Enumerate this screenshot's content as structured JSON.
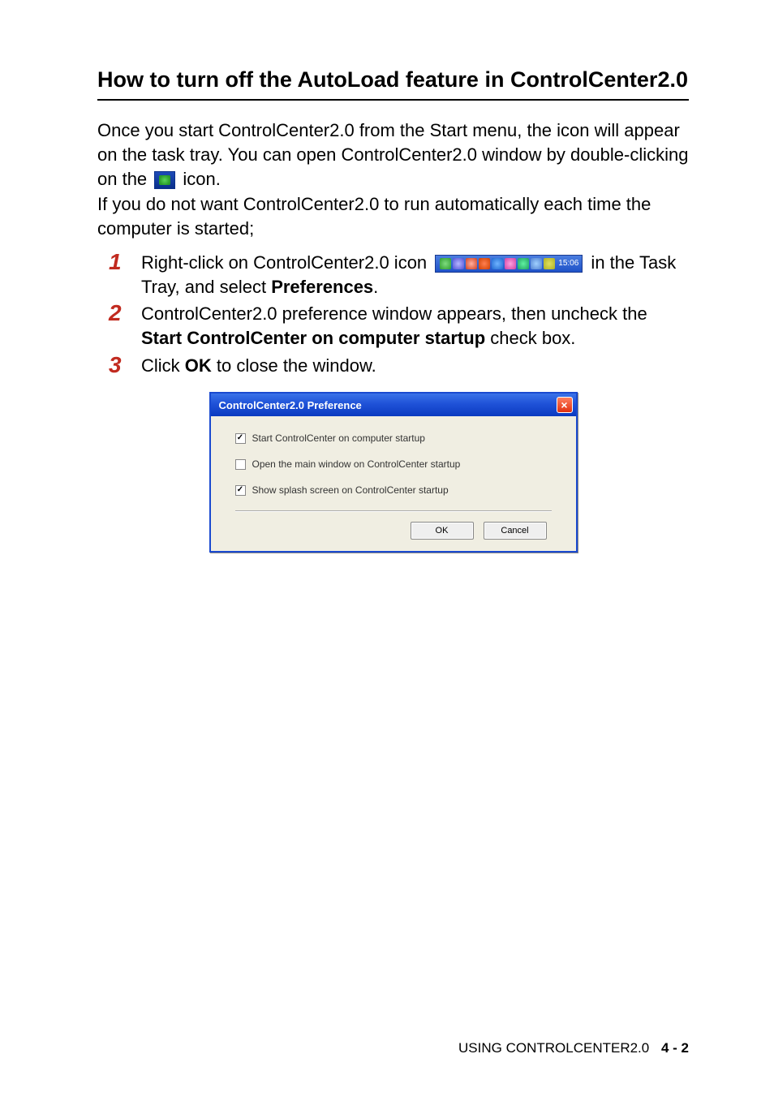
{
  "heading": "How to turn off the AutoLoad feature in ControlCenter2.0",
  "para1_a": "Once you start ControlCenter2.0 from the Start menu, the icon will appear on the task tray. You can open ControlCenter2.0 window by double-clicking on the ",
  "para1_b": " icon.",
  "para2": "If you do not want ControlCenter2.0 to run automatically each time the computer is started;",
  "steps": {
    "s1": {
      "num": "1",
      "a": "Right-click on ControlCenter2.0 icon ",
      "b": " in the Task Tray, and select ",
      "bold": "Preferences",
      "c": "."
    },
    "s2": {
      "num": "2",
      "a": "ControlCenter2.0 preference window appears, then uncheck the ",
      "bold": "Start ControlCenter on computer startup",
      "b": " check box."
    },
    "s3": {
      "num": "3",
      "a": "Click ",
      "bold": "OK",
      "b": " to close the window."
    }
  },
  "tray_time": "15:06",
  "dialog": {
    "title": "ControlCenter2.0 Preference",
    "opt1": "Start ControlCenter on computer startup",
    "opt2": "Open the main window on ControlCenter startup",
    "opt3": "Show splash screen on ControlCenter startup",
    "ok": "OK",
    "cancel": "Cancel"
  },
  "footer": {
    "text": "USING CONTROLCENTER2.0",
    "page": "4 - 2"
  }
}
